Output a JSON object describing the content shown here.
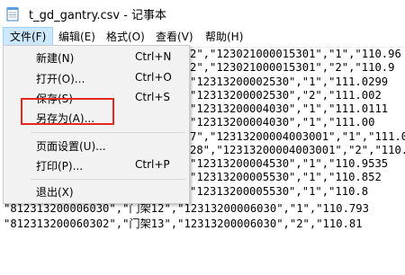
{
  "window": {
    "title": "t_gd_gantry.csv - 记事本",
    "icon": "notepad-icon"
  },
  "menubar": {
    "items": [
      "文件(F)",
      "编辑(E)",
      "格式(O)",
      "查看(V)",
      "帮助(H)"
    ],
    "active": "文件(F)"
  },
  "file_menu": {
    "items": [
      {
        "label": "新建(N)",
        "shortcut": "Ctrl+N"
      },
      {
        "label": "打开(O)...",
        "shortcut": "Ctrl+O"
      },
      {
        "label": "保存(S)",
        "shortcut": "Ctrl+S"
      },
      {
        "label": "另存为(A)...",
        "shortcut": ""
      },
      {
        "label": "页面设置(U)...",
        "shortcut": ""
      },
      {
        "label": "打印(P)...",
        "shortcut": "Ctrl+P"
      },
      {
        "label": "退出(X)",
        "shortcut": ""
      }
    ],
    "highlighted": "另存为(A)...",
    "highlight_color": "#e8271f"
  },
  "editor": {
    "lines": [
      "2\",\"123021000015301\",\"1\",\"110.96",
      "2\",\"123021000015301\",\"2\",\"110.9",
      "\"12313200002530\",\"1\",\"111.0299",
      "\"12313200002530\",\"2\",\"111.002",
      "\"12313200004030\",\"1\",\"111.0111",
      "\"12313200004030\",\"1\",\"111.00",
      "7\",\"12313200004003001\",\"1\",\"111.0",
      "28\",\"12313200004003001\",\"2\",\"110.",
      "\"12313200004530\",\"1\",\"110.9535",
      "\"12313200005530\",\"1\",\"110.852",
      "\"12313200005530\",\"1\",\"110.8",
      "\"812313200006030\",\"门架12\",\"12313200006030\",\"1\",\"110.793",
      "\"812313200060302\",\"门架13\",\"12313200006030\",\"2\",\"110.81"
    ]
  }
}
